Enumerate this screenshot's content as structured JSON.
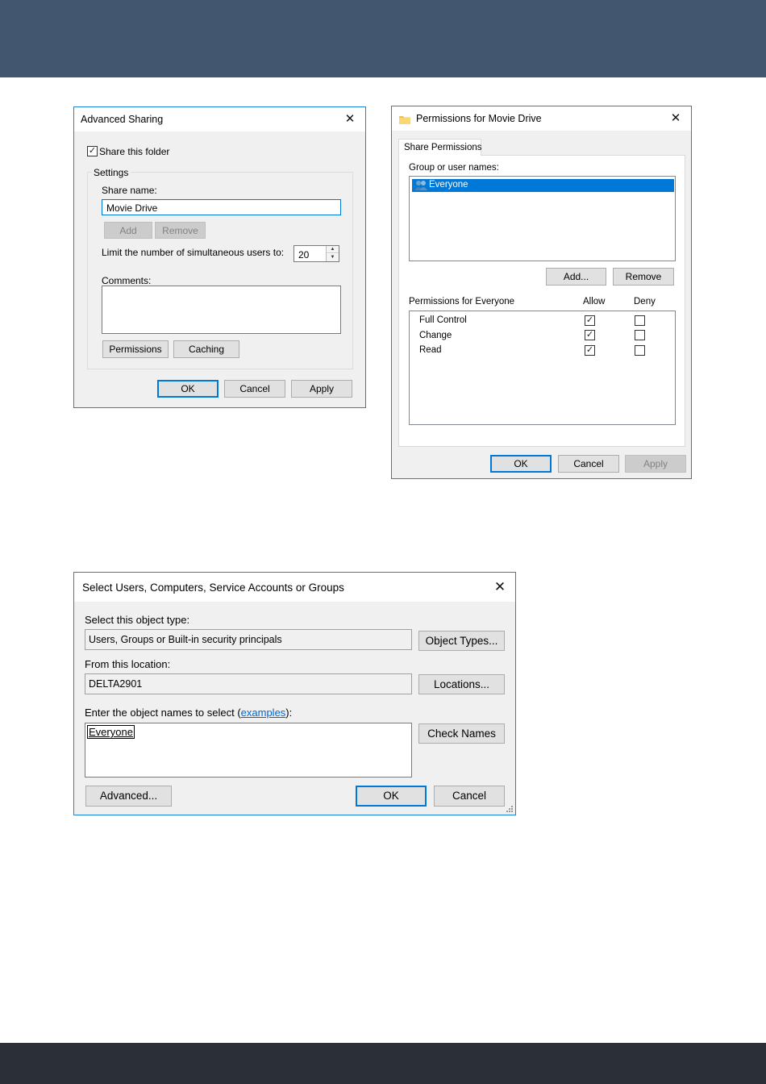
{
  "advanced_sharing": {
    "title": "Advanced Sharing",
    "share_checkbox_label": "Share this folder",
    "share_checked": true,
    "settings_group_label": "Settings",
    "share_name_label": "Share name:",
    "share_name_value": "Movie Drive",
    "add_button": "Add",
    "remove_button": "Remove",
    "limit_label": "Limit the number of simultaneous users to:",
    "limit_value": "20",
    "comments_label": "Comments:",
    "comments_value": "",
    "permissions_button": "Permissions",
    "caching_button": "Caching",
    "ok_button": "OK",
    "cancel_button": "Cancel",
    "apply_button": "Apply"
  },
  "permissions_dialog": {
    "title": "Permissions for Movie Drive",
    "tab_label": "Share Permissions",
    "group_label": "Group or user names:",
    "users": [
      "Everyone"
    ],
    "add_button": "Add...",
    "remove_button": "Remove",
    "perm_for_label": "Permissions for Everyone",
    "allow_header": "Allow",
    "deny_header": "Deny",
    "permissions": [
      {
        "name": "Full Control",
        "allow": true,
        "deny": false
      },
      {
        "name": "Change",
        "allow": true,
        "deny": false
      },
      {
        "name": "Read",
        "allow": true,
        "deny": false
      }
    ],
    "ok_button": "OK",
    "cancel_button": "Cancel",
    "apply_button": "Apply"
  },
  "select_users_dialog": {
    "title": "Select Users, Computers, Service Accounts or Groups",
    "object_type_label": "Select this object type:",
    "object_type_value": "Users, Groups or Built-in security principals",
    "object_types_button": "Object Types...",
    "location_label": "From this location:",
    "location_value": "DELTA2901",
    "locations_button": "Locations...",
    "enter_names_label_prefix": "Enter the object names to select (",
    "examples_link": "examples",
    "enter_names_label_suffix": "):",
    "names_value": "Everyone",
    "check_names_button": "Check Names",
    "advanced_button": "Advanced...",
    "ok_button": "OK",
    "cancel_button": "Cancel"
  },
  "icons": {
    "close": "close-icon",
    "folder": "folder-icon",
    "users": "users-group-icon",
    "check": "checkmark-icon",
    "resize": "resize-grip-icon"
  },
  "colors": {
    "header_band": "#42566f",
    "footer_band": "#2a2f38",
    "accent": "#0078d7",
    "dialog_bg": "#f0f0f0"
  }
}
